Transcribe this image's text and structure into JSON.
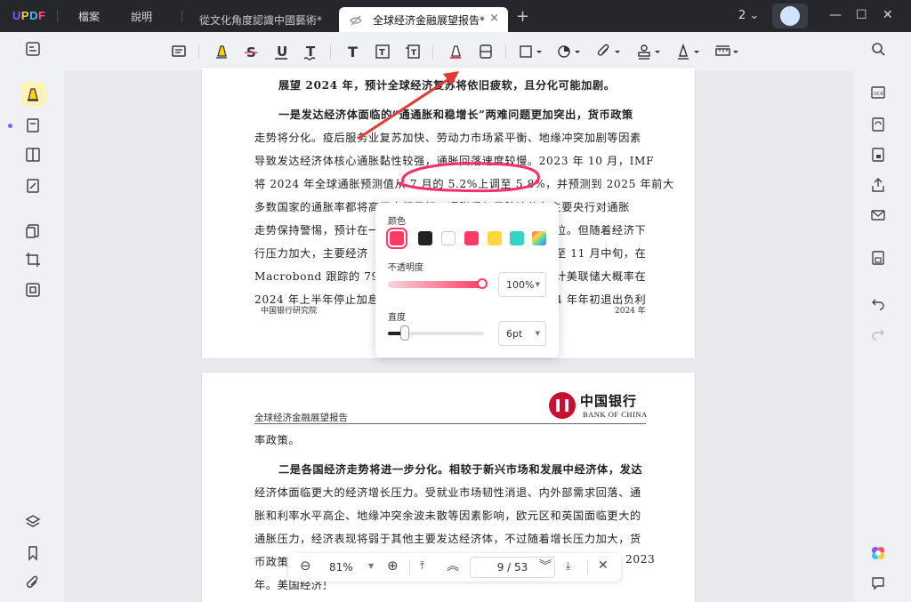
{
  "app": {
    "menu": [
      "檔案",
      "說明"
    ],
    "tabs": [
      {
        "label": "從文化角度認識中國藝術*"
      },
      {
        "label": "全球经济金融展望报告*"
      }
    ],
    "page_count_indicator": "2"
  },
  "document": {
    "page1_lines": [
      "展望 2024 年，预计全球经济复苏将依旧疲软，且分化可能加剧。",
      "一是发达经济体面临的“通通胀和稳增长”两难问题更加突出，货币政策",
      "走势将分化。疫后服务业复苏加快、劳动力市场紧平衡、地缘冲突加剧等因素",
      "导致发达经济体核心通胀黏性较强，通胀回落速度较慢。2023 年 10 月，IMF",
      "将 2024 年全球通胀预测值从 7 月的 5.2%上调至 5.8%，并预测到 2025 年前大",
      "多数国家的通胀率都将高于央行目标。通胀反复风险迫使各主要央行对通胀",
      "走势保持警惕，预计在一",
      "行压力加大，主要经济",
      "Macrobond 跟踪的 79 家",
      "2024 年上半年停止加息"
    ],
    "page1_right_fragments": [
      "位。但随着经济下",
      "至 11 月中旬，在",
      "计美联储大概率在",
      "4 年年初退出负利"
    ],
    "page1_footer_left": "中国银行研究院",
    "page1_footer_right": "2024 年",
    "page2_header": "全球经济金融展望报告",
    "page2_logo_cn": "中国银行",
    "page2_logo_en": "BANK OF CHINA",
    "page2_lines": [
      "率政策。",
      "二是各国经济走势将进一步分化。相较于新兴市场和发展中经济体，发达",
      "经济体面临更大的经济增长压力。受就业市场韧性消退、内外部需求回落、通",
      "胀和利率水平高企、地缘冲突余波未散等因素影响，欧元区和英国面临更大的",
      "通胀压力，经济表现将弱于其他主要发达经济体，不过随着增长压力加大，货",
      "币政策",
      "年。美国经济只"
    ],
    "page2_right_fragment": "2023"
  },
  "color_popup": {
    "color_label": "颜色",
    "swatches": [
      "#ff3b64",
      "#222222",
      "#ffffff",
      "#ff3b64",
      "#ffd93b",
      "#36d3c2",
      "rainbow"
    ],
    "opacity_label": "不透明度",
    "opacity_value": "100%",
    "opacity_fraction": 1.0,
    "width_label": "直度",
    "width_value": "6pt"
  },
  "nav": {
    "zoom": "81%",
    "page_current": "9",
    "page_total": "53",
    "page_display": "9 / 53"
  },
  "colors": {
    "accent": "#ff3b64",
    "arrow": "#e53935"
  }
}
